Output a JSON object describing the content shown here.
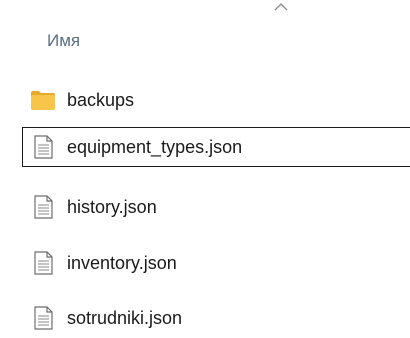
{
  "header": {
    "column_name": "Имя",
    "sort_icon": "chevron-up-icon"
  },
  "files": [
    {
      "name": "backups",
      "type": "folder",
      "icon": "folder-icon"
    },
    {
      "name": "equipment_types.json",
      "type": "file",
      "icon": "file-icon",
      "focused": true
    },
    {
      "name": "history.json",
      "type": "file",
      "icon": "file-icon"
    },
    {
      "name": "inventory.json",
      "type": "file",
      "icon": "file-icon"
    },
    {
      "name": "sotrudniki.json",
      "type": "file",
      "icon": "file-icon"
    }
  ],
  "colors": {
    "header_text": "#5a6e85",
    "folder": "#f6c54a",
    "text": "#1a1a1a",
    "focus_border": "#1a1a1a"
  }
}
